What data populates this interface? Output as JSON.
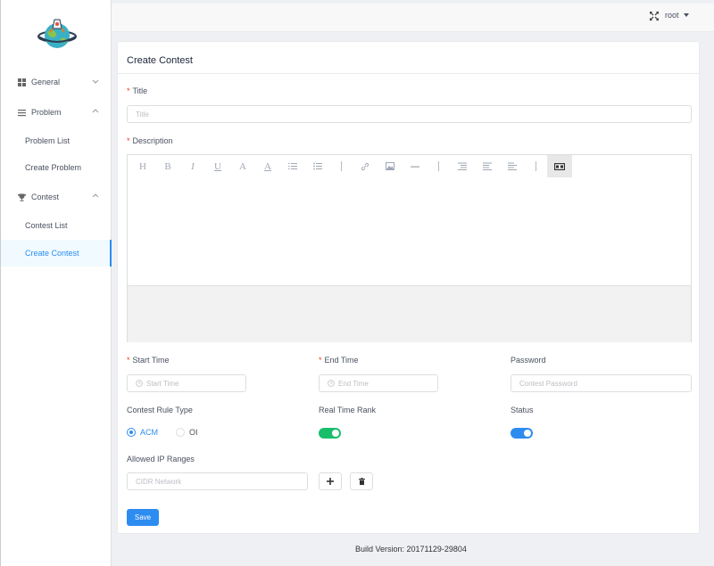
{
  "sidebar": {
    "general": "General",
    "problem": "Problem",
    "problem_list": "Problem List",
    "create_problem": "Create Problem",
    "contest": "Contest",
    "contest_list": "Contest List",
    "create_contest": "Create Contest"
  },
  "header": {
    "user": "root"
  },
  "form": {
    "heading": "Create Contest",
    "title_label": "Title",
    "title_placeholder": "Title",
    "description_label": "Description",
    "start_label": "Start Time",
    "start_placeholder": "Start Time",
    "end_label": "End Time",
    "end_placeholder": "End Time",
    "password_label": "Password",
    "password_placeholder": "Contest Password",
    "rule_label": "Contest Rule Type",
    "rule_options": [
      "ACM",
      "OI"
    ],
    "rule_selected": "ACM",
    "realtime_label": "Real Time Rank",
    "realtime_on": true,
    "status_label": "Status",
    "status_on": true,
    "ip_label": "Allowed IP Ranges",
    "ip_placeholder": "CIDR Network",
    "save": "Save"
  },
  "editor_toolbar": [
    "H",
    "B",
    "I",
    "U",
    "A",
    "A",
    "ol",
    "ul",
    "|",
    "link",
    "image",
    "hr",
    "|",
    "indent",
    "outdent",
    "align",
    "|",
    "preview"
  ],
  "footer": {
    "build": "Build Version: 20171129-29804"
  },
  "colors": {
    "accent": "#2d8cf0",
    "switch_green": "#19be6b",
    "required": "#ed3f14"
  }
}
